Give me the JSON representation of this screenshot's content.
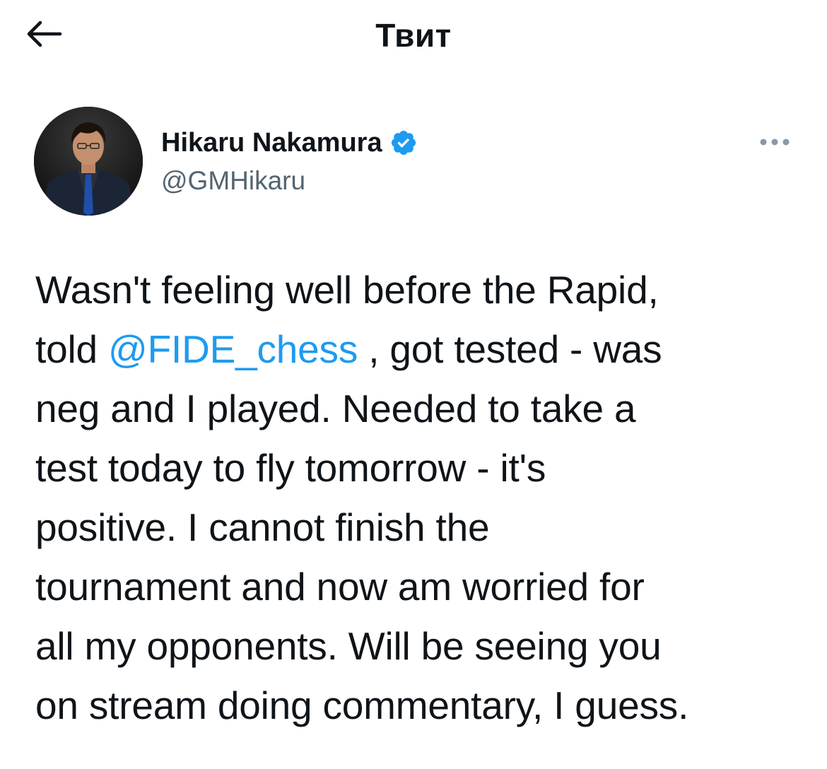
{
  "header": {
    "title": "Твит",
    "back_icon": "arrow-left-icon"
  },
  "author": {
    "name": "Hikaru Nakamura",
    "handle": "@GMHikaru",
    "verified": true,
    "verified_icon": "verified-badge-icon",
    "verified_color": "#1d9bf0"
  },
  "more_menu": {
    "icon": "more-horizontal-icon"
  },
  "tweet": {
    "lines": [
      {
        "before": "Wasn't feeling well before the Rapid,",
        "mention": "",
        "after": ""
      },
      {
        "before": "told ",
        "mention": "@FIDE_chess",
        "after": " , got tested - was"
      },
      {
        "before": "neg and I played. Needed to take a",
        "mention": "",
        "after": ""
      },
      {
        "before": "test today to fly tomorrow - it's",
        "mention": "",
        "after": ""
      },
      {
        "before": "positive. I cannot finish the",
        "mention": "",
        "after": ""
      },
      {
        "before": "tournament and now am worried for",
        "mention": "",
        "after": ""
      },
      {
        "before": "all my opponents. Will be seeing you",
        "mention": "",
        "after": ""
      },
      {
        "before": "on stream doing commentary, I guess.",
        "mention": "",
        "after": ""
      }
    ]
  },
  "colors": {
    "text": "#0f1419",
    "secondary": "#536471",
    "link": "#1d9bf0",
    "background": "#ffffff"
  }
}
